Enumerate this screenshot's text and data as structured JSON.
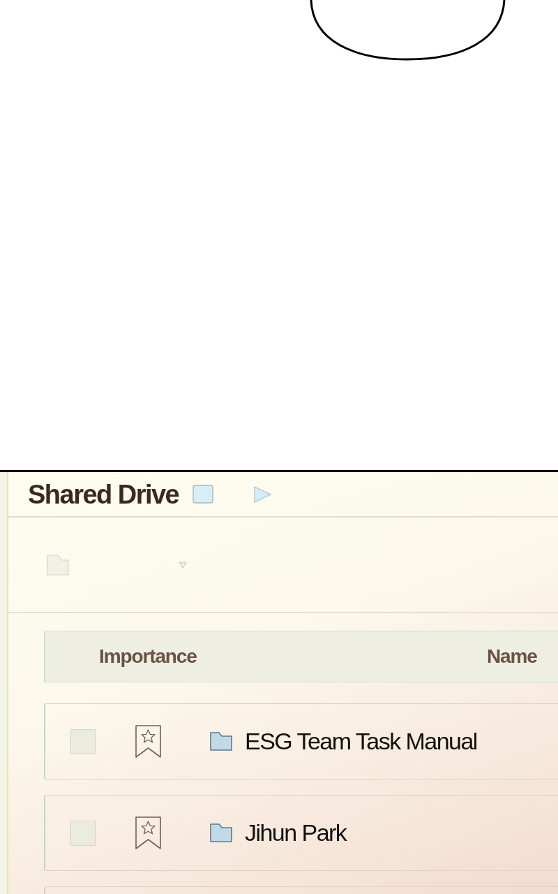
{
  "drive": {
    "title": "Shared Drive"
  },
  "table": {
    "columns": [
      "Importance",
      "Name"
    ],
    "rows": [
      {
        "checked": false,
        "important": false,
        "name": "ESG Team Task Manual"
      },
      {
        "checked": false,
        "important": false,
        "name": "Jihun Park"
      }
    ]
  }
}
